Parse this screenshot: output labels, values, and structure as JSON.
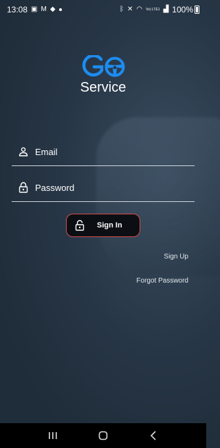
{
  "status_bar": {
    "time": "13:08",
    "battery": "100%",
    "network": "Vo) LTE1"
  },
  "app": {
    "brand_name": "Service",
    "logo_letters": "GO"
  },
  "form": {
    "email_placeholder": "Email",
    "password_placeholder": "Password",
    "sign_in_label": "Sign In"
  },
  "links": {
    "sign_up": "Sign Up",
    "forgot_password": "Forgot Password"
  },
  "colors": {
    "accent": "#1d8cf0",
    "button_border": "#d34f4f",
    "background": "#243344"
  }
}
